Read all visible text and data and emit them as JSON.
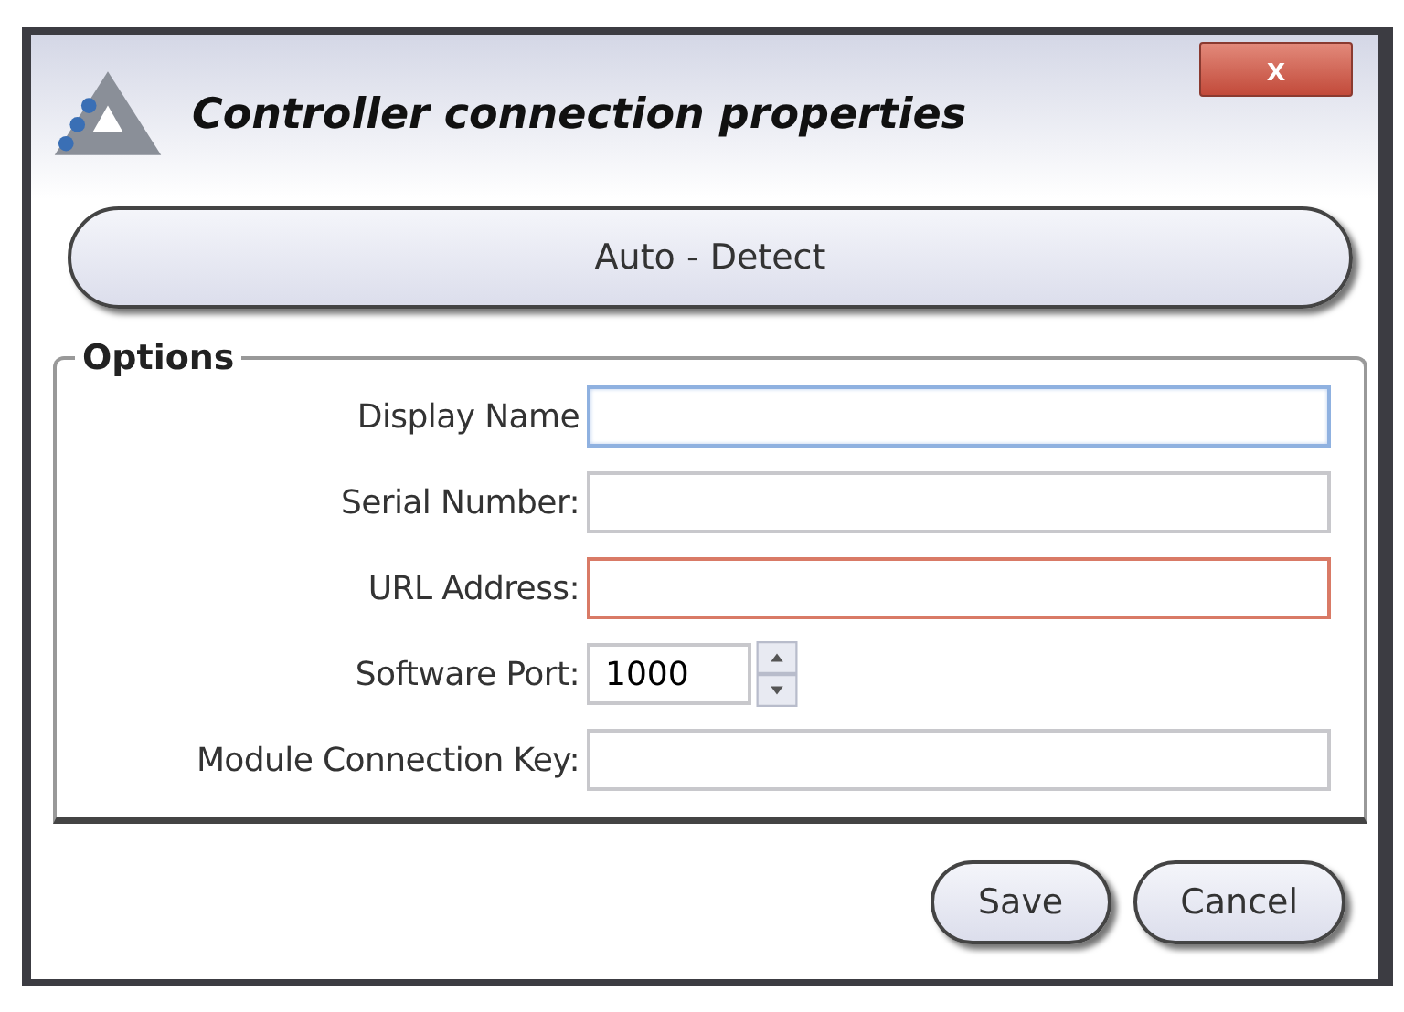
{
  "window": {
    "title": "Controller connection properties",
    "close": "x"
  },
  "auto_detect_button": "Auto - Detect",
  "options": {
    "legend": "Options",
    "fields": [
      {
        "label": "Display Name",
        "kind": "text",
        "focused": true,
        "invalid": false
      },
      {
        "label": "Serial Number:",
        "kind": "text",
        "focused": false,
        "invalid": false
      },
      {
        "label": "URL Address:",
        "kind": "text",
        "focused": false,
        "invalid": true
      },
      {
        "label": "Software Port:",
        "kind": "spinner",
        "focused": false,
        "invalid": false,
        "value": "1000"
      },
      {
        "label": "Module Connection Key:",
        "kind": "text",
        "focused": false,
        "invalid": false
      }
    ]
  },
  "buttons": [
    "Save",
    "Cancel"
  ]
}
